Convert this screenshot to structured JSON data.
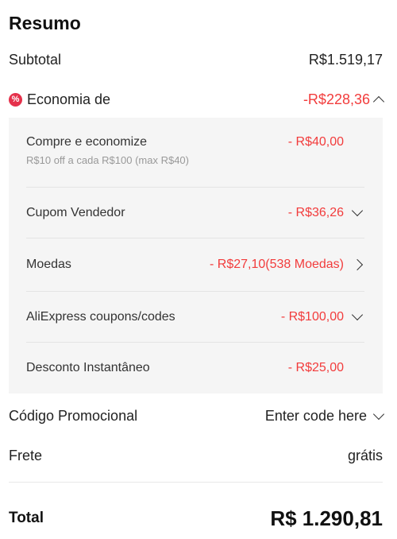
{
  "summary": {
    "title": "Resumo",
    "subtotal_label": "Subtotal",
    "subtotal_value": "R$1.519,17",
    "savings_label": "Economia de",
    "savings_value": "-R$228,36",
    "savings_icon": "discount-badge-icon"
  },
  "discounts": [
    {
      "label": "Compre e economize",
      "sub": "R$10 off a cada R$100 (max R$40)",
      "value": "- R$40,00",
      "chevron": "none"
    },
    {
      "label": "Cupom Vendedor",
      "value": "- R$36,26",
      "chevron": "down"
    },
    {
      "label": "Moedas",
      "value": "- R$27,10(538 Moedas)",
      "chevron": "right"
    },
    {
      "label": "AliExpress coupons/codes",
      "value": "- R$100,00",
      "chevron": "down"
    },
    {
      "label": "Desconto Instantâneo",
      "value": "- R$25,00",
      "chevron": "none"
    }
  ],
  "promo": {
    "label": "Código Promocional",
    "placeholder": "Enter code here"
  },
  "shipping": {
    "label": "Frete",
    "value": "grátis"
  },
  "total": {
    "label": "Total",
    "value": "R$ 1.290,81"
  },
  "colors": {
    "accent_red": "#f23c3c",
    "panel_bg": "#f5f5f5",
    "badge_red": "#e5314b"
  }
}
